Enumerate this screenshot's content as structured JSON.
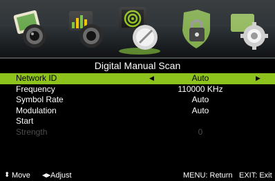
{
  "nav": {
    "icons": [
      {
        "name": "picture-icon"
      },
      {
        "name": "sound-icon"
      },
      {
        "name": "channel-icon",
        "active": true
      },
      {
        "name": "lock-icon"
      },
      {
        "name": "setup-icon"
      }
    ]
  },
  "title": "Digital Manual Scan",
  "menu": {
    "items": [
      {
        "label": "Network ID",
        "value": "Auto",
        "selected": true
      },
      {
        "label": "Frequency",
        "value": "110000 KHz"
      },
      {
        "label": "Symbol Rate",
        "value": "Auto"
      },
      {
        "label": "Modulation",
        "value": "Auto"
      },
      {
        "label": "Start",
        "value": ""
      },
      {
        "label": "Strength",
        "value": "0",
        "disabled": true
      }
    ]
  },
  "footer": {
    "move_label": "Move",
    "adjust_label": "Adjust",
    "menu_hint": "MENU: Return",
    "exit_hint": "EXIT: Exit"
  },
  "colors": {
    "highlight": "#8ec21c",
    "background": "#000000",
    "disabled_text": "#4c4c4c"
  }
}
